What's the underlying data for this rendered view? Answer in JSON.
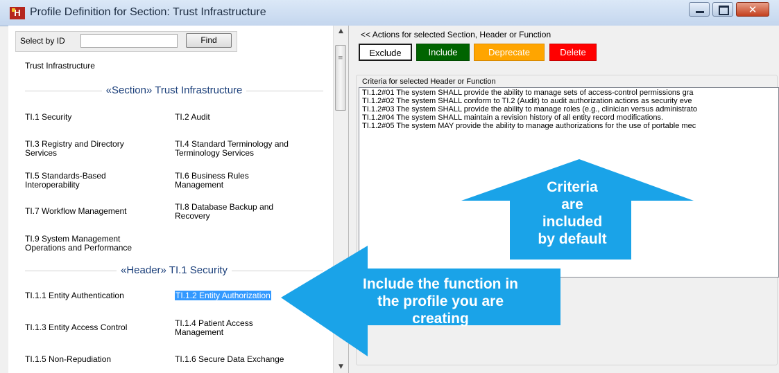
{
  "window": {
    "title": "Profile Definition for Section: Trust Infrastructure",
    "app_icon_text": "H"
  },
  "select_by_id": {
    "label": "Select by ID",
    "value": "",
    "find_label": "Find"
  },
  "left": {
    "section_title": "Trust Infrastructure",
    "section_header": "«Section» Trust Infrastructure",
    "section_items": [
      {
        "label": "TI.1 Security"
      },
      {
        "label": "TI.2 Audit"
      },
      {
        "label": "TI.3 Registry and Directory Services"
      },
      {
        "label": "TI.4 Standard Terminology and Terminology Services"
      },
      {
        "label": "TI.5 Standards-Based Interoperability"
      },
      {
        "label": "TI.6 Business Rules Management"
      },
      {
        "label": "TI.7 Workflow Management"
      },
      {
        "label": "TI.8 Database Backup and Recovery"
      },
      {
        "label": "TI.9 System Management Operations and Performance"
      }
    ],
    "header_header": "«Header» TI.1 Security",
    "header_items": [
      {
        "label": "TI.1.1 Entity Authentication"
      },
      {
        "label": "TI.1.2 Entity Authorization",
        "selected": true
      },
      {
        "label": "TI.1.3 Entity Access Control"
      },
      {
        "label": "TI.1.4 Patient Access Management"
      },
      {
        "label": "TI.1.5 Non-Repudiation"
      },
      {
        "label": "TI.1.6 Secure Data Exchange"
      }
    ]
  },
  "actions": {
    "label": "<< Actions for selected Section, Header or Function",
    "exclude": "Exclude",
    "include": "Include",
    "deprecate": "Deprecate",
    "delete": "Delete",
    "colors": {
      "include": "#006400",
      "deprecate": "#ffa500",
      "delete": "#ff0000"
    }
  },
  "criteria": {
    "label": "Criteria for selected Header or Function",
    "lines": [
      "TI.1.2#01 The system SHALL provide the ability to manage sets of access-control permissions gra",
      "TI.1.2#02 The system SHALL conform to TI.2 (Audit) to audit authorization actions as security eve",
      "TI.1.2#03 The system SHALL provide the ability to manage roles (e.g., clinician versus administrato",
      "TI.1.2#04 The system SHALL maintain a revision history of all entity record modifications.",
      "TI.1.2#05 The system MAY provide the ability to manage authorizations for the use of portable mec"
    ]
  },
  "callouts": {
    "criteria_text": [
      "Criteria",
      "are",
      "included",
      "by default"
    ],
    "include_text": [
      "Include the function in",
      "the profile you are",
      "creating"
    ],
    "color": "#1aa3e8"
  }
}
